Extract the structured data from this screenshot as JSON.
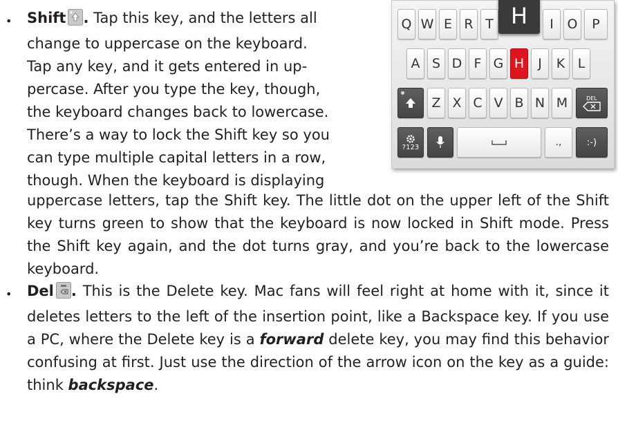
{
  "bullets": {
    "glyph": "•"
  },
  "shift_item": {
    "term": "Shift",
    "period": ".",
    "lines": [
      " Tap this key, and the letters all",
      "change to uppercase on the keyboard.",
      "Tap any key, and it gets entered in up-",
      "percase. After you type the key, though,",
      "the keyboard changes back to lowercase.",
      "There’s a way to lock the Shift key so you",
      "can type multiple capital letters in a row,",
      "though. When the keyboard is displaying"
    ],
    "continuation": "uppercase letters, tap the Shift key. The little dot on the upper left of the Shift key turns green to show that the keyboard is now locked in Shift mode. Press the Shift key again, and the dot turns gray, and you’re back to the lowercase keyboard."
  },
  "del_item": {
    "term": "Del",
    "period": ".",
    "text_1": " This is the Delete key. Mac fans will feel right at home with it, since it deletes letters to the left of the insertion point, like a Backspace key. If you use a PC, where the Delete key is a ",
    "emph_1": "forward",
    "text_2": " delete key, you may find this behavior confusing at first. Just use the direction of the arrow icon on the key as a guide: think ",
    "emph_2": "backspace",
    "text_3": "."
  },
  "keyboard": {
    "row1": [
      "Q",
      "W",
      "E",
      "R",
      "T",
      "",
      "",
      "I",
      "O",
      "P"
    ],
    "row2": [
      "A",
      "S",
      "D",
      "F",
      "G",
      "H",
      "J",
      "K",
      "L"
    ],
    "row3": [
      "Z",
      "X",
      "C",
      "V",
      "B",
      "N",
      "M"
    ],
    "popup": "H",
    "pressed_key": "H",
    "del_label": "DEL",
    "symbols_label": "?123",
    "period_key": ".,",
    "emoji_key": ":-)",
    "colors": {
      "pressed": "#e0141c",
      "dark_key": "#4f4f4f"
    }
  }
}
